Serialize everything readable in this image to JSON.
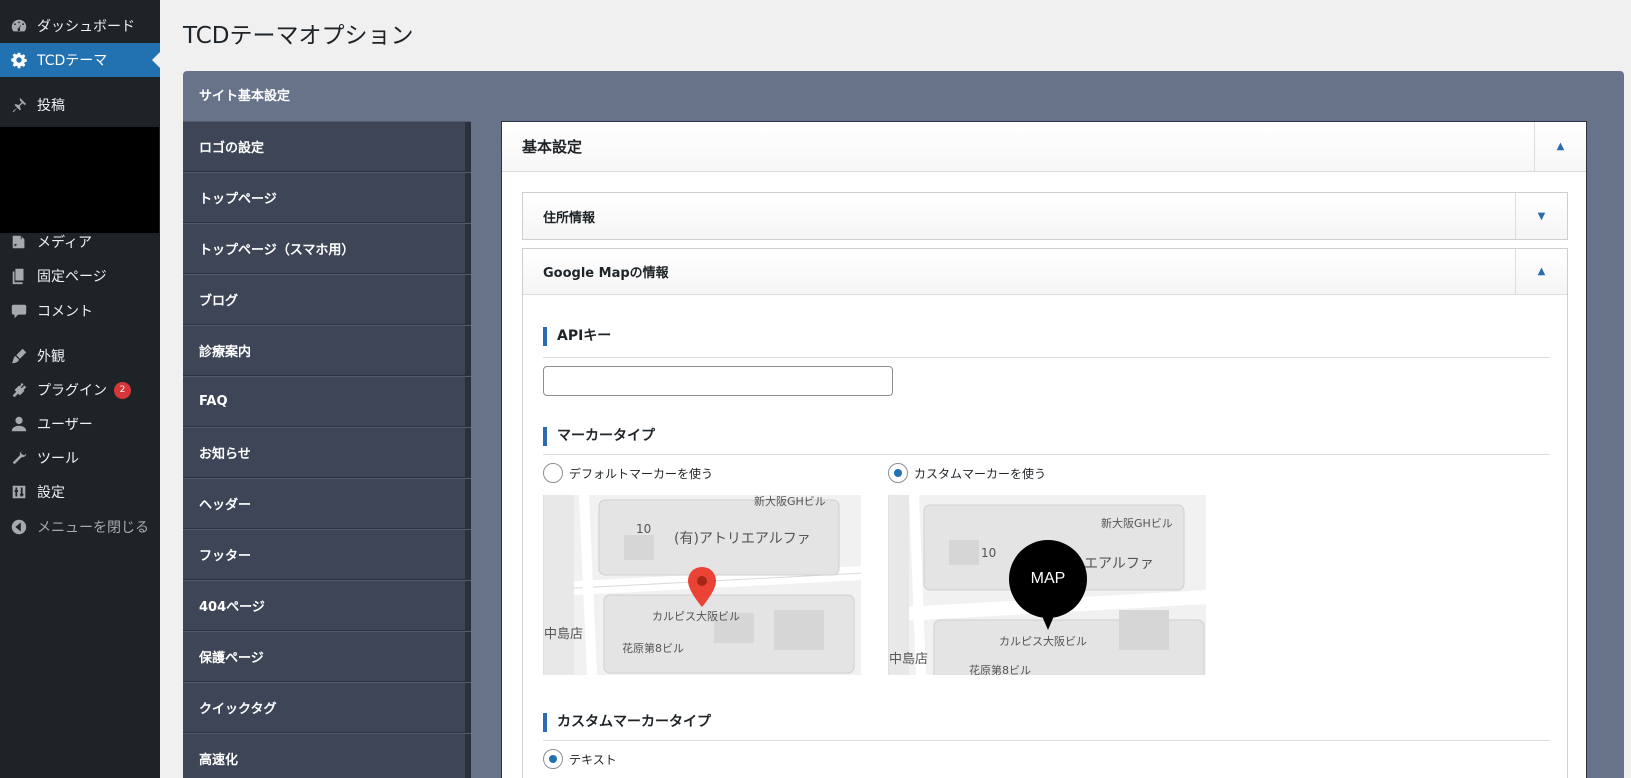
{
  "admin_menu": {
    "items": [
      {
        "label": "ダッシュボード",
        "icon": "dashboard-icon"
      },
      {
        "label": "TCDテーマ",
        "icon": "gear-icon"
      },
      {
        "label": "投稿",
        "icon": "pin-icon"
      },
      {
        "label": "メディア",
        "icon": "media-icon"
      },
      {
        "label": "固定ページ",
        "icon": "page-icon"
      },
      {
        "label": "コメント",
        "icon": "comment-icon"
      },
      {
        "label": "外観",
        "icon": "brush-icon"
      },
      {
        "label": "プラグイン",
        "icon": "plugin-icon",
        "badge": "2"
      },
      {
        "label": "ユーザー",
        "icon": "user-icon"
      },
      {
        "label": "ツール",
        "icon": "wrench-icon"
      },
      {
        "label": "設定",
        "icon": "settings-icon"
      },
      {
        "label": "メニューを閉じる",
        "icon": "collapse-icon"
      }
    ]
  },
  "page_title": "TCDテーマオプション",
  "panel": {
    "heading": "サイト基本設定",
    "nav": [
      "ロゴの設定",
      "トップページ",
      "トップページ（スマホ用）",
      "ブログ",
      "診療案内",
      "FAQ",
      "お知らせ",
      "ヘッダー",
      "フッター",
      "404ページ",
      "保護ページ",
      "クイックタグ",
      "高速化"
    ]
  },
  "card": {
    "title": "基本設定",
    "address_section": "住所情報",
    "map_section": "Google Mapの情報",
    "api_key_label": "APIキー",
    "api_key_value": "",
    "marker_type_label": "マーカータイプ",
    "marker_default": "デフォルトマーカーを使う",
    "marker_custom": "カスタムマーカーを使う",
    "marker_selected": "custom",
    "custom_marker_type_label": "カスタムマーカータイプ",
    "custom_marker_text": "テキスト",
    "custom_marker_selected": "text"
  },
  "maps": {
    "default": {
      "labels": [
        "新大阪GHビル",
        "10",
        "(有)アトリエアルファ",
        "カルピス大阪ビル",
        "中島店",
        "花原第8ビル"
      ]
    },
    "custom": {
      "labels": [
        "新大阪GHビル",
        "10",
        "エアルファ",
        "カルピス大阪ビル",
        "中島店",
        "花原第8ビル"
      ],
      "marker_text": "MAP"
    }
  },
  "colors": {
    "sidebar": "#1d2327",
    "active": "#2271b1",
    "panel": "#677389",
    "nav": "#3d4556",
    "accent": "#2b6bb2",
    "badge": "#d63638"
  }
}
